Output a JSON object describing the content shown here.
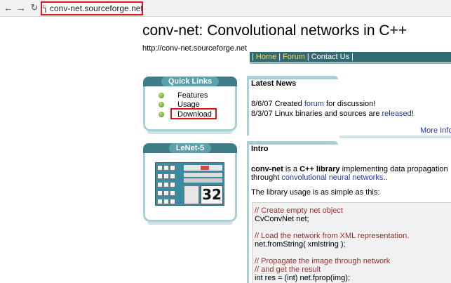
{
  "browser": {
    "url": "conv-net.sourceforge.net"
  },
  "header": {
    "title": "conv-net: Convolutional networks in C++",
    "url_text": "http://conv-net.sourceforge.net",
    "nav": [
      {
        "label": "Home"
      },
      {
        "label": "Forum"
      },
      {
        "label": "Contact Us"
      }
    ]
  },
  "quick_links": {
    "title": "Quick Links",
    "items": [
      {
        "label": "Features"
      },
      {
        "label": "Usage"
      },
      {
        "label": "Download"
      }
    ]
  },
  "lenet": {
    "title": "LeNet-5",
    "digit": "32"
  },
  "latest_news": {
    "title": "Latest News",
    "items": [
      {
        "prefix": "8/6/07 Created ",
        "link": "forum",
        "suffix": " for discussion!"
      },
      {
        "prefix": "8/3/07 Linux binaries and sources are ",
        "link": "released",
        "suffix": "!"
      }
    ],
    "more": "More Info"
  },
  "intro": {
    "title": "Intro",
    "p1_bold1": "conv-net",
    "p1_mid": " is a ",
    "p1_bold2": "C++ library",
    "p1_rest": " implementing data propagation",
    "p2_pre": "throught ",
    "p2_link": "convolutional neural networks",
    "p2_post": "..",
    "p3": "The library usage is as simple as this:",
    "code": [
      {
        "text": "// Create empty net object",
        "comment": true
      },
      {
        "text": "CvConvNet net;",
        "comment": false
      },
      {
        "text": "",
        "comment": false
      },
      {
        "text": "// Load the network from XML representation.",
        "comment": true
      },
      {
        "text": "net.fromString( xmlstring );",
        "comment": false
      },
      {
        "text": "",
        "comment": false
      },
      {
        "text": "// Propagate the image through network",
        "comment": true
      },
      {
        "text": "// and get the result",
        "comment": true
      },
      {
        "text": "int res = (int) net.fprop(img);",
        "comment": false
      }
    ]
  }
}
